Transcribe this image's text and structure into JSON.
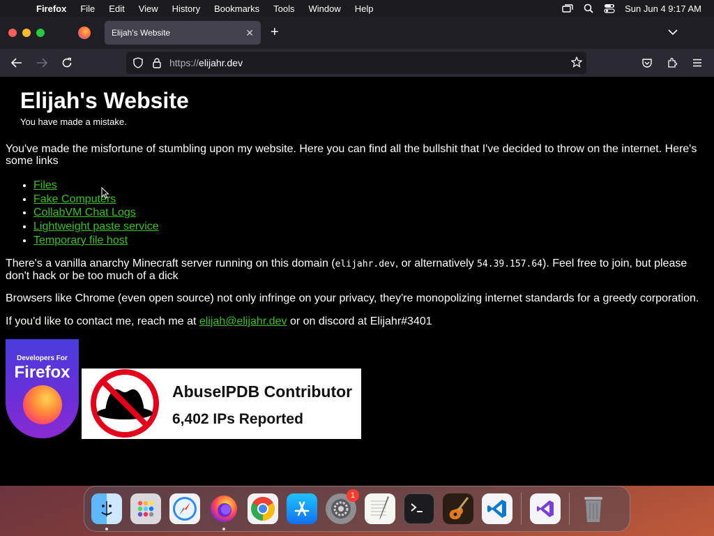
{
  "menubar": {
    "app_name": "Firefox",
    "items": [
      "File",
      "Edit",
      "View",
      "History",
      "Bookmarks",
      "Tools",
      "Window",
      "Help"
    ],
    "clock": "Sun Jun 4  9:17 AM"
  },
  "browser": {
    "tab_title": "Elijah's Website",
    "url_scheme": "https://",
    "url_host": "elijahr.dev"
  },
  "page": {
    "title": "Elijah's Website",
    "tagline": "You have made a mistake.",
    "intro": "You've made the misfortune of stumbling upon my website. Here you can find all the bullshit that I've decided to throw on the internet. Here's some links",
    "links": [
      "Files",
      "Fake Computers",
      "CollabVM Chat Logs",
      "Lightweight paste service",
      "Temporary file host"
    ],
    "minecraft_a": "There's a vanilla anarchy Minecraft server running on this domain (",
    "minecraft_domain": "elijahr.dev",
    "minecraft_b": ", or alternatively ",
    "minecraft_ip": "54.39.157.64",
    "minecraft_c": "). Feel free to join, but please don't hack or be too much of a dick",
    "browsers": "Browsers like Chrome (even open source) not only infringe on your privacy, they're monopolizing internet standards for a greedy corporation.",
    "contact_a": "If you'd like to contact me, reach me at ",
    "contact_email": "elijah@elijahr.dev",
    "contact_b": " or on discord at Elijahr#3401",
    "firefox_badge_small": "Developers For",
    "firefox_badge_big": "Firefox",
    "abuse_title": "AbuseIPDB Contributor",
    "abuse_count": "6,402 IPs Reported"
  },
  "dock": {
    "settings_badge": "1",
    "apps": [
      "finder-icon",
      "launchpad-icon",
      "safari-icon",
      "firefox-icon",
      "chrome-icon",
      "app-store-icon",
      "system-settings-icon",
      "textedit-icon",
      "terminal-icon",
      "garageband-icon",
      "vscode-icon",
      "visual-studio-icon",
      "trash-icon"
    ]
  },
  "colors": {
    "link": "#39c020",
    "page_bg": "#000000",
    "tab_active": "#42414d",
    "toolbar": "#2b2a33"
  }
}
